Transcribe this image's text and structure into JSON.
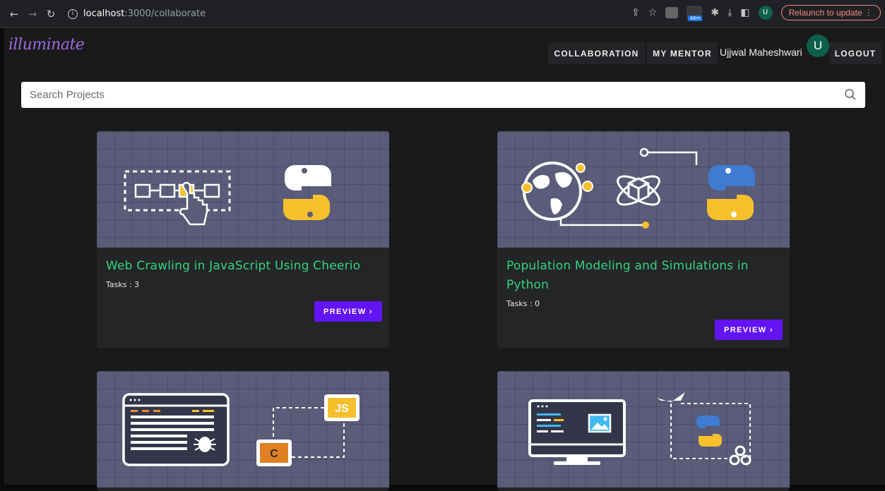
{
  "browser": {
    "url_host": "localhost",
    "url_path": ":3000/collaborate",
    "extension_badge": "46m",
    "profile_initial": "U",
    "relaunch_label": "Relaunch to update"
  },
  "app": {
    "logo": "illuminate",
    "nav": {
      "collaboration": "COLLABORATION",
      "my_mentor": "MY MENTOR",
      "user_name": "Ujjwal Maheshwari",
      "avatar_initial": "U",
      "logout": "LOGOUT"
    },
    "search": {
      "placeholder": "Search Projects"
    }
  },
  "projects": [
    {
      "title": "Web Crawling in JavaScript Using Cheerio",
      "tasks_label": "Tasks : 3",
      "preview_label": "PREVIEW ›"
    },
    {
      "title": "Population Modeling and Simulations in Python",
      "tasks_label": "Tasks : 0",
      "preview_label": "PREVIEW ›"
    },
    {
      "title": "",
      "tasks_label": "",
      "preview_label": ""
    },
    {
      "title": "",
      "tasks_label": "",
      "preview_label": ""
    }
  ],
  "icons": {
    "js_badge": "JS",
    "cheerio_badge": "C"
  },
  "colors": {
    "accent_green": "#36d27e",
    "preview_purple": "#6314f2",
    "avatar_green": "#0f5f4d"
  }
}
